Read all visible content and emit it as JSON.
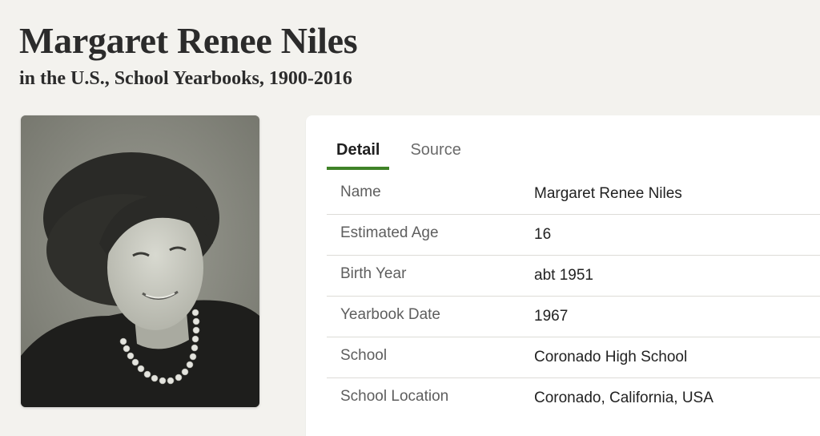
{
  "header": {
    "title": "Margaret Renee Niles",
    "subtitle": "in the U.S., School Yearbooks, 1900-2016"
  },
  "tabs": [
    {
      "label": "Detail",
      "active": true
    },
    {
      "label": "Source",
      "active": false
    }
  ],
  "details": [
    {
      "label": "Name",
      "value": "Margaret Renee Niles"
    },
    {
      "label": "Estimated Age",
      "value": "16"
    },
    {
      "label": "Birth Year",
      "value": "abt 1951"
    },
    {
      "label": "Yearbook Date",
      "value": "1967"
    },
    {
      "label": "School",
      "value": "Coronado High School"
    },
    {
      "label": "School Location",
      "value": "Coronado, California, USA"
    }
  ],
  "colors": {
    "background": "#f3f2ee",
    "card": "#ffffff",
    "active_tab_underline": "#3f8227",
    "divider": "#dddcd7"
  }
}
